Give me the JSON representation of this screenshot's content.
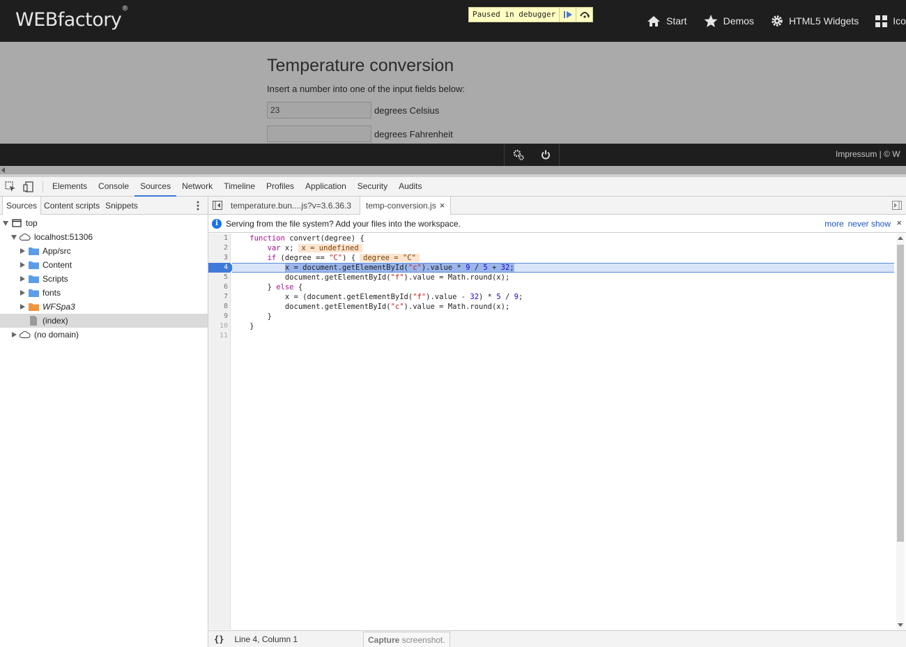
{
  "site": {
    "logo": "WEBfactory",
    "logo_mark": "®",
    "debugger_text": "Paused in debugger",
    "nav": [
      {
        "label": "Start",
        "icon": "home-icon"
      },
      {
        "label": "Demos",
        "icon": "star-icon"
      },
      {
        "label": "HTML5 Widgets",
        "icon": "gear-icon"
      },
      {
        "label": "Icon",
        "icon": "grid-icon"
      }
    ],
    "title": "Temperature conversion",
    "instructions": "Insert a number into one of the input fields below:",
    "celsius_value": "23",
    "celsius_label": "degrees Celsius",
    "fahrenheit_value": "",
    "fahrenheit_label": "degrees Fahrenheit",
    "footer_text": "Impressum | © W"
  },
  "devtools": {
    "tabs": [
      "Elements",
      "Console",
      "Sources",
      "Network",
      "Timeline",
      "Profiles",
      "Application",
      "Security",
      "Audits"
    ],
    "active_tab": "Sources",
    "navigator_tabs": [
      "Sources",
      "Content scripts",
      "Snippets"
    ],
    "tree": {
      "top": "top",
      "host": "localhost:51306",
      "folders": [
        "App/src",
        "Content",
        "Scripts",
        "fonts",
        "WFSpa3"
      ],
      "index": "(index)",
      "no_domain": "(no domain)"
    },
    "file_tabs": [
      "temperature.bun....js?v=3.6.36.3",
      "temp-conversion.js"
    ],
    "infobar": {
      "message": "Serving from the file system? Add your files into the workspace.",
      "more": "more",
      "never_show": "never show"
    },
    "code": {
      "line_numbers": [
        "1",
        "2",
        "3",
        "4",
        "5",
        "6",
        "7",
        "8",
        "9",
        "10",
        "11"
      ],
      "current_line": 4,
      "inline_values": [
        "x = undefined",
        "degree = \"C\""
      ]
    },
    "status": {
      "pretty_print": "{}",
      "cursor": "Line 4, Column 1",
      "capture_bold": "Capture",
      "capture_rest": " screenshot."
    }
  },
  "colors": {
    "accent": "#3879d9",
    "execution_line": "#3e7ad9",
    "inline_value_bg": "#fbe4d0",
    "debugger_pill": "#ffffc2"
  }
}
